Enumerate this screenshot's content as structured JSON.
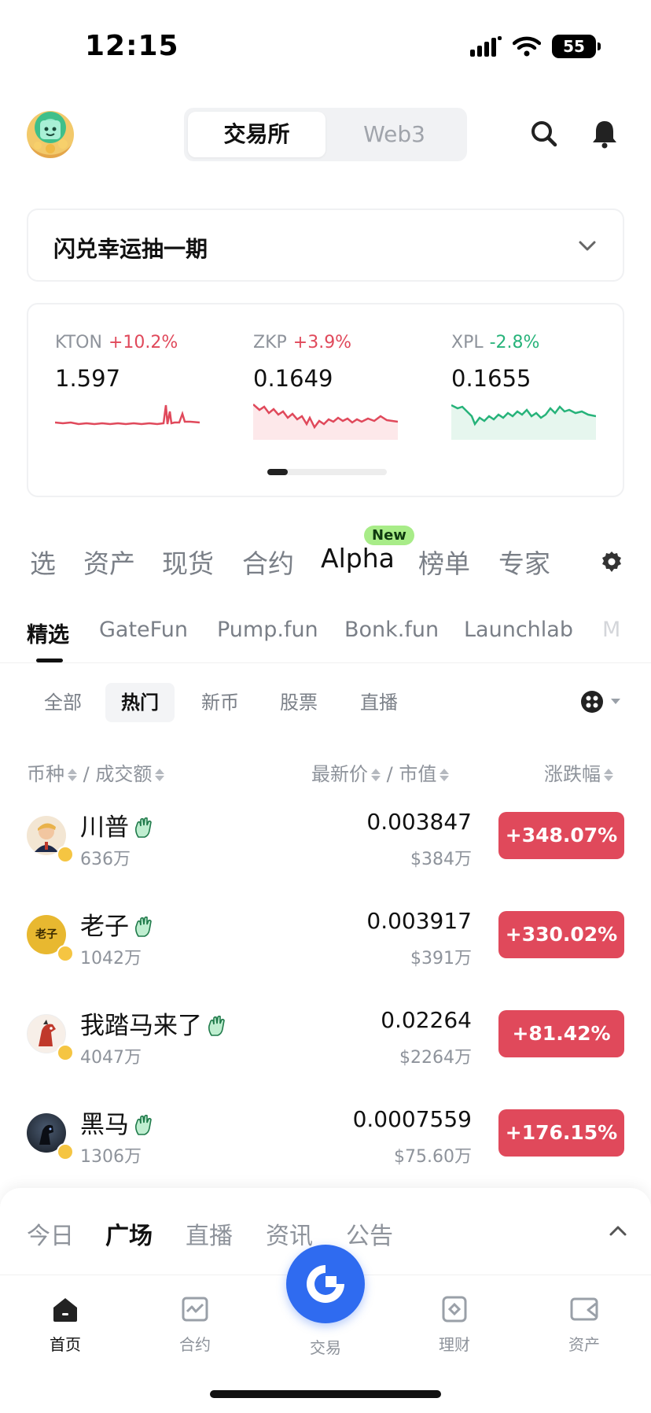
{
  "status_bar": {
    "time": "12:15",
    "battery": "55"
  },
  "header": {
    "segments": [
      "交易所",
      "Web3"
    ],
    "active_segment": 0,
    "search_icon": "search-icon",
    "bell_icon": "bell-icon"
  },
  "promo": {
    "text": "闪兑幸运抽一期"
  },
  "tickers": [
    {
      "symbol": "KTON",
      "change": "+10.2%",
      "price": "1.597",
      "direction": "up"
    },
    {
      "symbol": "ZKP",
      "change": "+3.9%",
      "price": "0.1649",
      "direction": "up"
    },
    {
      "symbol": "XPL",
      "change": "-2.8%",
      "price": "0.1655",
      "direction": "down"
    }
  ],
  "main_tabs": [
    "选",
    "资产",
    "现货",
    "合约",
    "Alpha",
    "榜单",
    "专家"
  ],
  "main_tab_active": "Alpha",
  "new_badge": "New",
  "sub_tabs": [
    "精选",
    "GateFun",
    "Pump.fun",
    "Bonk.fun",
    "Launchlab",
    "M"
  ],
  "filters": [
    "全部",
    "热门",
    "新币",
    "股票",
    "直播"
  ],
  "columns": {
    "coin": "币种",
    "sep": "/",
    "volume": "成交额",
    "price": "最新价",
    "cap": "市值",
    "change": "涨跌幅"
  },
  "rows": [
    {
      "name": "川普",
      "volume": "636万",
      "price": "0.003847",
      "cap": "$384万",
      "change": "+348.07%"
    },
    {
      "name": "老子",
      "volume": "1042万",
      "price": "0.003917",
      "cap": "$391万",
      "change": "+330.02%",
      "avatar_text": "老子"
    },
    {
      "name": "我踏马来了",
      "volume": "4047万",
      "price": "0.02264",
      "cap": "$2264万",
      "change": "+81.42%"
    },
    {
      "name": "黑马",
      "volume": "1306万",
      "price": "0.0007559",
      "cap": "$75.60万",
      "change": "+176.15%"
    }
  ],
  "sheet_tabs": [
    "今日",
    "广场",
    "直播",
    "资讯",
    "公告"
  ],
  "sheet_active": "广场",
  "nav": [
    {
      "label": "首页",
      "icon": "home-icon"
    },
    {
      "label": "合约",
      "icon": "futures-icon"
    },
    {
      "label": "交易",
      "icon": "trade-icon"
    },
    {
      "label": "理财",
      "icon": "earn-icon"
    },
    {
      "label": "资产",
      "icon": "wallet-icon"
    }
  ],
  "colors": {
    "up": "#e0495b",
    "down": "#27b37a",
    "accent": "#2f6bf0",
    "badge_green": "#a8ec88"
  }
}
